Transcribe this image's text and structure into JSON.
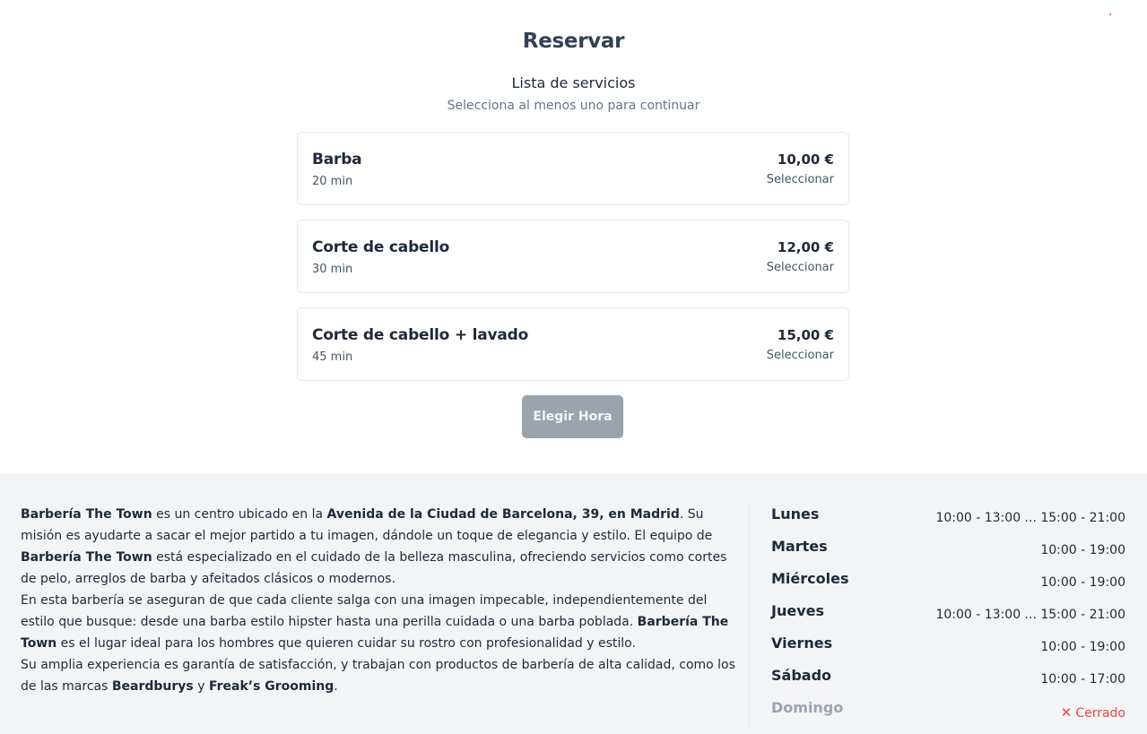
{
  "header": {
    "title": "Reservar",
    "subtitle": "Lista de servicios",
    "hint": "Selecciona al menos uno para continuar"
  },
  "services": [
    {
      "name": "Barba",
      "duration": "20 min",
      "price": "10,00 €",
      "action": "Seleccionar"
    },
    {
      "name": "Corte de cabello",
      "duration": "30 min",
      "price": "12,00 €",
      "action": "Seleccionar"
    },
    {
      "name": "Corte de cabello + lavado",
      "duration": "45 min",
      "price": "15,00 €",
      "action": "Seleccionar"
    }
  ],
  "choose_button": "Elegir Hora",
  "about": {
    "p1": [
      {
        "text": "Barbería The Town",
        "bold": true
      },
      {
        "text": " es un centro ubicado en la ",
        "bold": false
      },
      {
        "text": "Avenida de la Ciudad de Barcelona, 39, en Madrid",
        "bold": true
      },
      {
        "text": ". Su misión es ayudarte a sacar el mejor partido a tu imagen, dándole un toque de elegancia y estilo. El equipo de ",
        "bold": false
      },
      {
        "text": "Barbería The Town",
        "bold": true
      },
      {
        "text": " está especializado en el cuidado de la belleza masculina, ofreciendo servicios como cortes de pelo, arreglos de barba y afeitados clásicos o modernos.",
        "bold": false
      }
    ],
    "p2": [
      {
        "text": "En esta barbería se aseguran de que cada cliente salga con una imagen impecable, independientemente del estilo que busque: desde una barba estilo hipster hasta una perilla cuidada o una barba poblada. ",
        "bold": false
      },
      {
        "text": "Barbería The Town",
        "bold": true
      },
      {
        "text": " es el lugar ideal para los hombres que quieren cuidar su rostro con profesionalidad y estilo.",
        "bold": false
      }
    ],
    "p3": [
      {
        "text": "Su amplia experiencia es garantía de satisfacción, y trabajan con productos de barbería de alta calidad, como los de las marcas ",
        "bold": false
      },
      {
        "text": "Beardburys",
        "bold": true
      },
      {
        "text": " y ",
        "bold": false
      },
      {
        "text": "Freak’s Grooming",
        "bold": true
      },
      {
        "text": ".",
        "bold": false
      }
    ]
  },
  "hours": [
    {
      "day": "Lunes",
      "time": "10:00 - 13:00 ... 15:00 - 21:00"
    },
    {
      "day": "Martes",
      "time": "10:00 - 19:00"
    },
    {
      "day": "Miércoles",
      "time": "10:00 - 19:00"
    },
    {
      "day": "Jueves",
      "time": "10:00 - 13:00 ... 15:00 - 21:00"
    },
    {
      "day": "Viernes",
      "time": "10:00 - 19:00"
    },
    {
      "day": "Sábado",
      "time": "10:00 - 17:00"
    },
    {
      "day": "Domingo",
      "time": "Cerrado",
      "closed": true,
      "icon": "close-icon"
    }
  ],
  "colors": {
    "accent_closed": "#ef4444",
    "button_disabled": "#9ca3af",
    "footer_bg": "#f3f4f6"
  }
}
